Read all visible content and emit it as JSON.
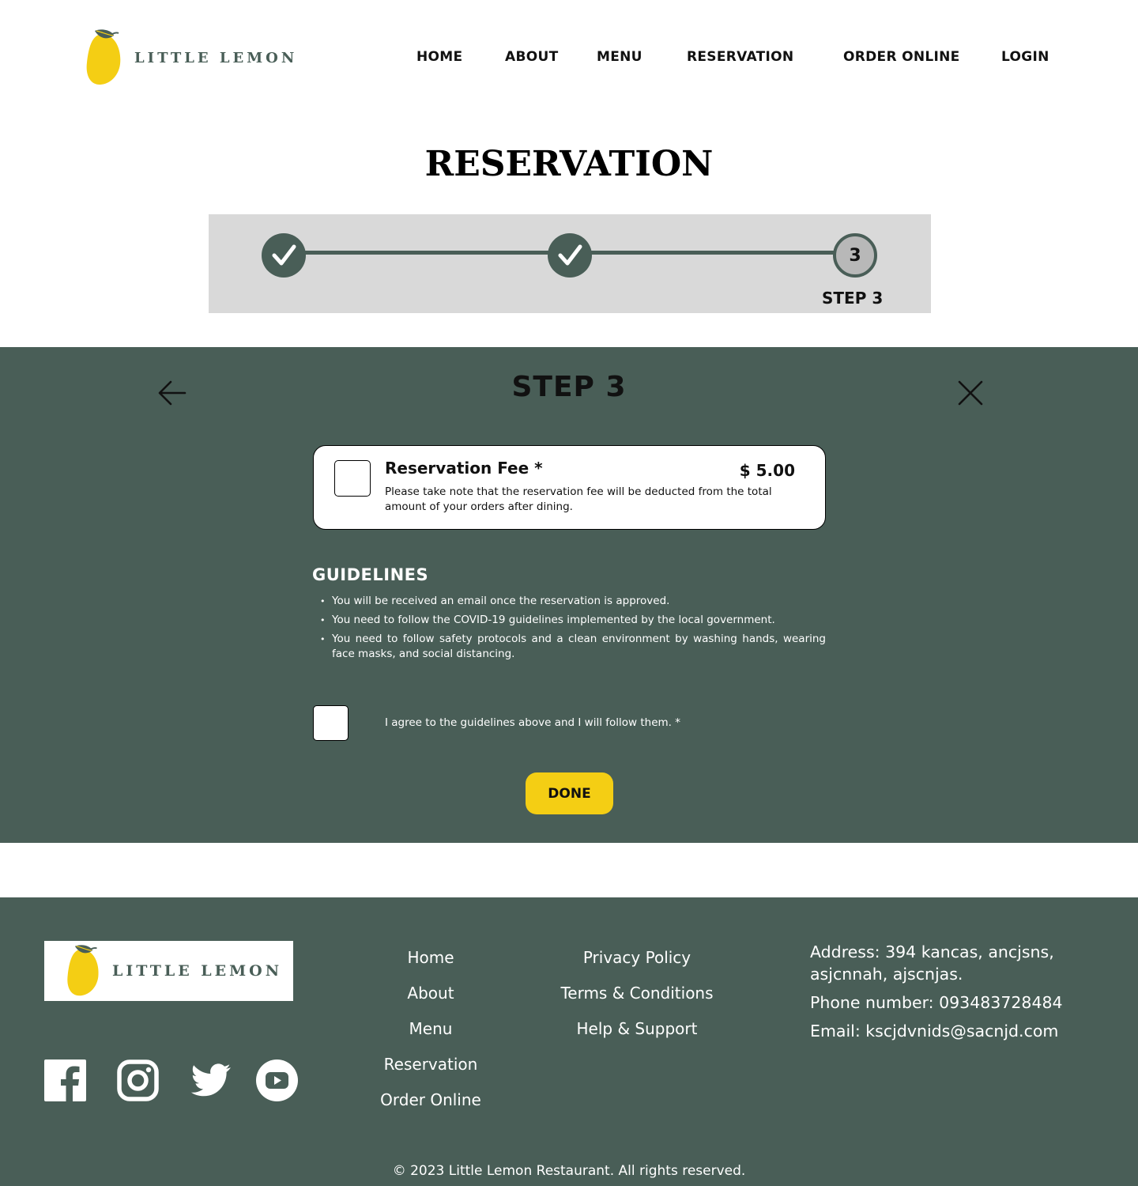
{
  "brand": {
    "name": "LITTLE LEMON",
    "colors": {
      "primary": "#495e57",
      "accent": "#f4ce14",
      "lemon": "#f4ce14",
      "leaf": "#495e57"
    }
  },
  "nav": {
    "items": [
      {
        "label": "HOME"
      },
      {
        "label": "ABOUT"
      },
      {
        "label": "MENU"
      },
      {
        "label": "RESERVATION"
      },
      {
        "label": "ORDER ONLINE"
      },
      {
        "label": "LOGIN"
      }
    ]
  },
  "page": {
    "title": "RESERVATION"
  },
  "progress": {
    "steps": [
      {
        "state": "complete",
        "icon": "check-icon"
      },
      {
        "state": "complete",
        "icon": "check-icon"
      },
      {
        "state": "current",
        "number": "3"
      }
    ],
    "current_label": "STEP 3"
  },
  "step_panel": {
    "title": "STEP 3",
    "back_icon": "arrow-left-icon",
    "close_icon": "close-icon",
    "fee": {
      "title": "Reservation Fee *",
      "price": "$ 5.00",
      "note": "Please take note that the reservation fee will be deducted from the total amount of your orders after dining.",
      "checked": false
    },
    "guidelines": {
      "title": "GUIDELINES",
      "items": [
        "You will be received an email once the reservation is approved.",
        "You need to follow the COVID-19 guidelines implemented by the local government.",
        "You need to follow safety protocols and a clean environment by washing hands, wearing face masks, and social distancing."
      ]
    },
    "agree": {
      "label": "I agree to the guidelines above and I will follow them.  *",
      "checked": false
    },
    "done_label": "DONE"
  },
  "footer": {
    "logo_text": "LITTLE LEMON",
    "social": [
      {
        "icon": "facebook-icon"
      },
      {
        "icon": "instagram-icon"
      },
      {
        "icon": "twitter-icon"
      },
      {
        "icon": "youtube-icon"
      }
    ],
    "nav_links": [
      "Home",
      "About",
      "Menu",
      "Reservation",
      "Order Online"
    ],
    "legal_links": [
      "Privacy Policy",
      "Terms & Conditions",
      "Help & Support"
    ],
    "contact": {
      "address": "Address: 394 kancas, ancjsns, asjcnnah, ajscnjas.",
      "phone": "Phone number: 093483728484",
      "email": "Email: kscjdvnids@sacnjd.com"
    },
    "copyright": "© 2023 Little Lemon Restaurant. All rights reserved."
  }
}
